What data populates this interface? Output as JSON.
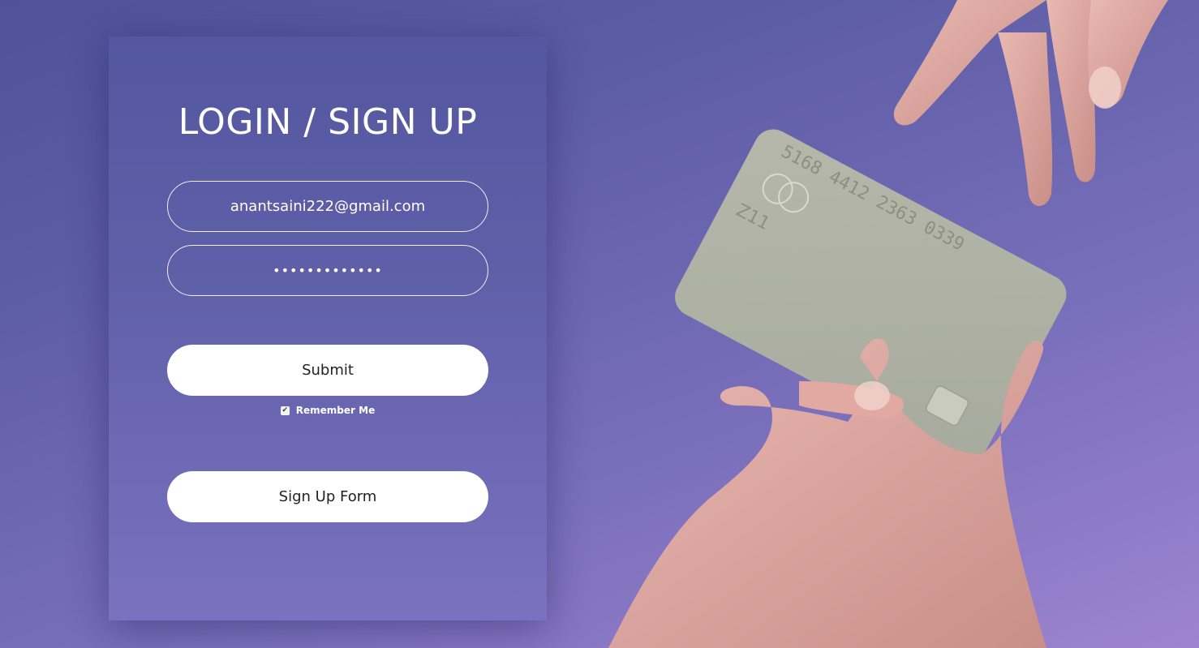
{
  "form": {
    "title": "LOGIN / SIGN UP",
    "email_value": "anantsaini222@gmail.com",
    "password_value": "•••••••••••••",
    "submit_label": "Submit",
    "remember_label": "Remember Me",
    "remember_checked": true,
    "signup_label": "Sign Up Form"
  },
  "card": {
    "number": "5168 4412 2363 0339",
    "expiry_fragment": "Z11"
  },
  "colors": {
    "background_top": "#4f5199",
    "background_bottom": "#9d84d0",
    "panel": "#5f5fa8",
    "button": "#ffffff",
    "card": "#b7bba8"
  },
  "icons": {
    "checkbox": "checkmark-icon"
  }
}
